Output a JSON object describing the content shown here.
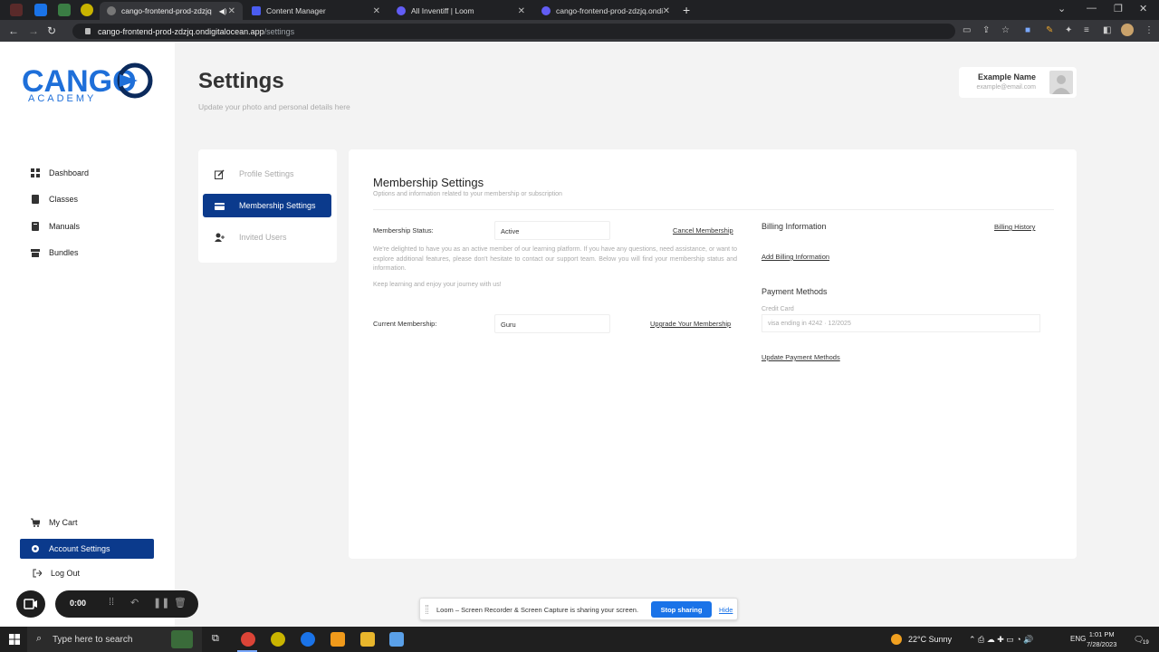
{
  "browser": {
    "tabs": [
      {
        "title": "cango-frontend-prod-zdzjq",
        "active": true
      },
      {
        "title": "Content Manager",
        "active": false
      },
      {
        "title": "All Inventiff | Loom",
        "active": false
      },
      {
        "title": "cango-frontend-prod-zdzjq.ondi",
        "active": false
      }
    ],
    "url_host": "cango-frontend-prod-zdzjq.ondigitalocean.app",
    "url_path": "/settings"
  },
  "sidebar": {
    "logo_text": "CANGO",
    "logo_sub": "ACADEMY",
    "items": [
      {
        "label": "Dashboard",
        "icon": "grid-icon"
      },
      {
        "label": "Classes",
        "icon": "book-icon"
      },
      {
        "label": "Manuals",
        "icon": "manual-icon"
      },
      {
        "label": "Bundles",
        "icon": "bundle-icon"
      }
    ],
    "bottom": [
      {
        "label": "My Cart",
        "icon": "cart-icon"
      },
      {
        "label": "Account Settings",
        "icon": "gear-icon"
      },
      {
        "label": "Log Out",
        "icon": "logout-icon"
      }
    ]
  },
  "header": {
    "title": "Settings",
    "subtitle": "Update your photo and personal details here",
    "user_name": "Example Name",
    "user_email": "example@email.com"
  },
  "settings_menu": [
    {
      "label": "Profile Settings"
    },
    {
      "label": "Membership Settings"
    },
    {
      "label": "Invited Users"
    }
  ],
  "membership": {
    "title": "Membership Settings",
    "subtitle": "Options and information related to your membership or subscription",
    "status_label": "Membership Status:",
    "status_value": "Active",
    "cancel_link": "Cancel Membership",
    "description": "We're delighted to have you as an active member of our learning platform. If you have any questions, need assistance, or want to explore additional features, please don't hesitate to contact our support team. Below you will find your membership status and information.",
    "closing": "Keep learning and enjoy your journey with us!",
    "current_label": "Current Membership:",
    "current_value": "Guru",
    "upgrade_link": "Upgrade Your Membership"
  },
  "billing": {
    "title": "Billing Information",
    "history_link": "Billing History",
    "add_link": "Add Billing Information",
    "methods_title": "Payment Methods",
    "card_label": "Credit Card",
    "card_value": "visa ending in 4242 · 12/2025",
    "update_link": "Update Payment Methods"
  },
  "loom": {
    "timer": "0:00",
    "share_msg": "Loom – Screen Recorder & Screen Capture is sharing your screen.",
    "stop_label": "Stop sharing",
    "hide_label": "Hide"
  },
  "taskbar": {
    "search_placeholder": "Type here to search",
    "weather": "22°C  Sunny",
    "lang": "ENG",
    "time": "1:01 PM",
    "date": "7/28/2023",
    "notifications": "19"
  },
  "colors": {
    "accent": "#0b3a8c",
    "logo_blue": "#1e6fd9",
    "logo_navy": "#0b2a5c"
  }
}
